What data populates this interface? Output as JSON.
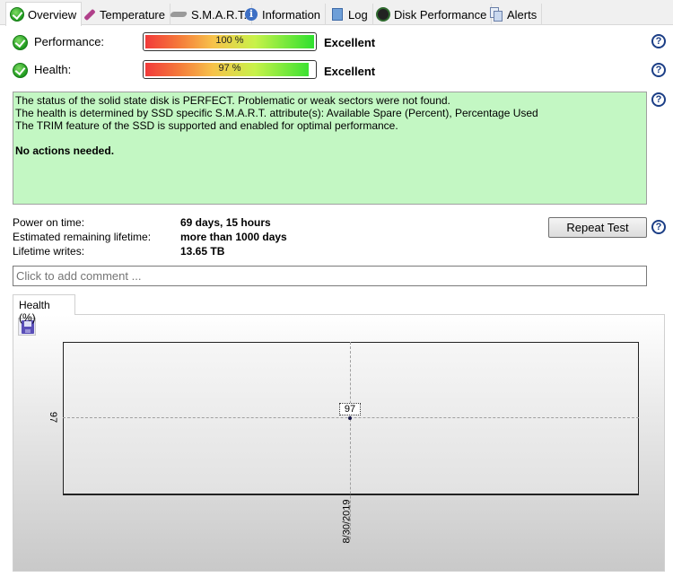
{
  "tabs": [
    {
      "label": "Overview",
      "icon": "check-circle-icon",
      "active": true
    },
    {
      "label": "Temperature",
      "icon": "thermometer-icon",
      "active": false
    },
    {
      "label": "S.M.A.R.T.",
      "icon": "disk-icon",
      "active": false
    },
    {
      "label": "Information",
      "icon": "info-icon",
      "active": false
    },
    {
      "label": "Log",
      "icon": "log-document-icon",
      "active": false
    },
    {
      "label": "Disk Performance",
      "icon": "gauge-icon",
      "active": false
    },
    {
      "label": "Alerts",
      "icon": "alerts-document-icon",
      "active": false
    }
  ],
  "performance": {
    "label": "Performance:",
    "value_text": "100 %",
    "percent": 100,
    "rating": "Excellent"
  },
  "health": {
    "label": "Health:",
    "value_text": "97 %",
    "percent": 97,
    "rating": "Excellent"
  },
  "status": {
    "lines": [
      "The status of the solid state disk is PERFECT. Problematic or weak sectors were not found.",
      "The health is determined by SSD specific S.M.A.R.T. attribute(s):  Available Spare (Percent), Percentage Used",
      "The TRIM feature of the SSD is supported and enabled for optimal performance."
    ],
    "action": "No actions needed.",
    "background": "#c3f7c3"
  },
  "info": {
    "power_on_label": "Power on time:",
    "power_on_value": "69 days, 15 hours",
    "remaining_label": "Estimated remaining lifetime:",
    "remaining_value": "more than 1000 days",
    "writes_label": "Lifetime writes:",
    "writes_value": "13.65 TB"
  },
  "repeat_button": "Repeat Test",
  "help_symbol": "?",
  "comment": {
    "placeholder": "Click to add comment ..."
  },
  "chart_tab": "Health (%)",
  "chart_data": {
    "type": "line",
    "title": "Health (%)",
    "x": [
      "8/30/2019"
    ],
    "series": [
      {
        "name": "Health (%)",
        "values": [
          97
        ]
      }
    ],
    "yticks": [
      "97"
    ],
    "xticks": [
      "8/30/2019"
    ],
    "point_labels": [
      "97"
    ],
    "grid": true
  }
}
